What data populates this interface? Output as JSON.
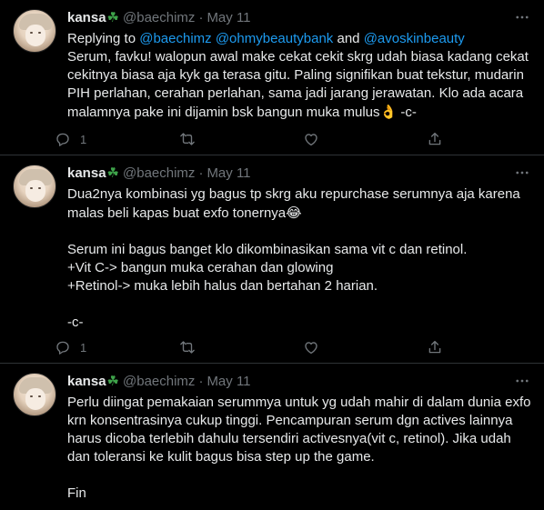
{
  "tweets": [
    {
      "name": "kansa",
      "handle": "@baechimz",
      "dot": "·",
      "date": "May 11",
      "replying_prefix": "Replying to ",
      "replying_to": [
        "@baechimz",
        "@ohmybeautybank",
        "@avoskinbeauty"
      ],
      "replying_and": " and ",
      "text": "Serum, favku! walopun awal make cekat cekit skrg udah biasa kadang cekat cekitnya biasa aja kyk ga terasa gitu. Paling signifikan buat tekstur, mudarin PIH perlahan, cerahan perlahan, sama jadi jarang jerawatan. Klo ada acara malamnya pake ini dijamin bsk bangun muka mulus",
      "text_emoji": "👌",
      "text_suffix": " -c-",
      "reply_count": "1"
    },
    {
      "name": "kansa",
      "handle": "@baechimz",
      "dot": "·",
      "date": "May 11",
      "text": "Dua2nya kombinasi yg bagus tp skrg aku repurchase serumnya aja karena malas beli kapas buat exfo tonernya",
      "text_emoji": "😂",
      "text_suffix": "\n\nSerum ini bagus banget klo dikombinasikan sama vit c dan retinol.\n+Vit C-> bangun muka cerahan dan glowing\n+Retinol-> muka lebih halus dan bertahan 2 harian.\n\n-c-",
      "reply_count": "1"
    },
    {
      "name": "kansa",
      "handle": "@baechimz",
      "dot": "·",
      "date": "May 11",
      "text": "Perlu diingat pemakaian serummya untuk yg udah mahir di dalam dunia exfo krn konsentrasinya cukup tinggi. Pencampuran serum dgn actives lainnya harus dicoba terlebih dahulu tersendiri activesnya(vit c, retinol). Jika udah dan toleransi ke kulit bagus bisa step up the game.\n\nFin"
    }
  ],
  "icons": {
    "name_badge": "four-leaf-clover-icon",
    "more": "more-dots-icon",
    "reply": "reply-icon",
    "retweet": "retweet-icon",
    "like": "heart-icon",
    "share": "share-icon"
  },
  "colors": {
    "background": "#000000",
    "text": "#e7e9ea",
    "muted": "#71767b",
    "link": "#1d9bf0",
    "divider": "#2f3336"
  }
}
